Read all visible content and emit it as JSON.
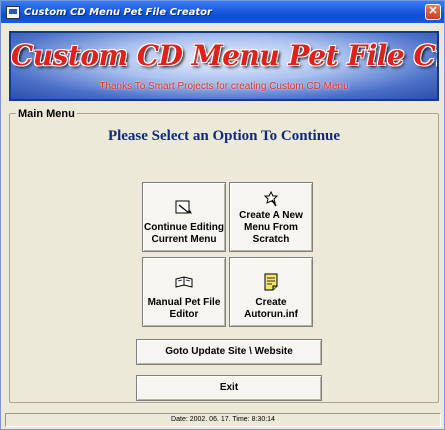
{
  "window": {
    "title": "Custom CD Menu Pet File Creator"
  },
  "banner": {
    "title": "Custom CD Menu Pet File Creator",
    "subtitle": "Thanks To Smart Projects for creating Custom CD Menu"
  },
  "main_menu": {
    "label": "Main Menu",
    "prompt": "Please Select an Option To Continue",
    "buttons": {
      "continue_editing": "Continue Editing Current Menu",
      "create_new_menu": "Create A New Menu From Scratch",
      "manual_editor": "Manual Pet File Editor",
      "create_autorun": "Create Autorun.inf",
      "goto_update_site": "Goto Update Site \\ Website",
      "exit": "Exit"
    }
  },
  "status_bar": {
    "text": "Date: 2002. 06. 17. Time: 8:30:14"
  },
  "icons": [
    "app-icon",
    "close-icon",
    "edit-icon",
    "wand-icon",
    "book-icon",
    "note-icon"
  ]
}
